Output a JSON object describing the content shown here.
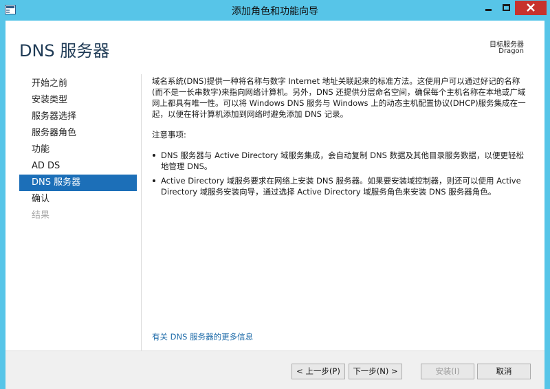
{
  "window": {
    "title": "添加角色和功能向导",
    "icon": "server-manager-icon"
  },
  "header": {
    "page_title": "DNS 服务器",
    "destination_label": "目标服务器",
    "destination_server": "Dragon"
  },
  "nav": {
    "items": [
      {
        "label": "开始之前",
        "state": "normal"
      },
      {
        "label": "安装类型",
        "state": "normal"
      },
      {
        "label": "服务器选择",
        "state": "normal"
      },
      {
        "label": "服务器角色",
        "state": "normal"
      },
      {
        "label": "功能",
        "state": "normal"
      },
      {
        "label": "AD DS",
        "state": "normal"
      },
      {
        "label": "DNS 服务器",
        "state": "active"
      },
      {
        "label": "确认",
        "state": "normal"
      },
      {
        "label": "结果",
        "state": "disabled"
      }
    ]
  },
  "main": {
    "description": "域名系统(DNS)提供一种将名称与数字 Internet 地址关联起来的标准方法。这使用户可以通过好记的名称(而不是一长串数字)来指向网络计算机。另外，DNS 还提供分层命名空间，确保每个主机名称在本地或广域网上都具有唯一性。可以将 Windows DNS 服务与 Windows 上的动态主机配置协议(DHCP)服务集成在一起，以便在将计算机添加到网络时避免添加 DNS 记录。",
    "notes_heading": "注意事项:",
    "notes": [
      "DNS 服务器与 Active Directory 域服务集成，会自动复制 DNS 数据及其他目录服务数据，以便更轻松地管理 DNS。",
      "Active Directory 域服务要求在网络上安装 DNS 服务器。如果要安装域控制器，则还可以使用 Active Directory 域服务安装向导，通过选择 Active Directory 域服务角色来安装 DNS 服务器角色。"
    ],
    "more_info_link": "有关 DNS 服务器的更多信息"
  },
  "footer": {
    "prev_label": "< 上一步(P)",
    "next_label": "下一步(N) >",
    "install_label": "安装(I)",
    "cancel_label": "取消"
  },
  "colors": {
    "frame": "#57c5e8",
    "active_nav": "#1c6fb8",
    "link": "#1c6aa8",
    "close_button": "#c7332d"
  }
}
